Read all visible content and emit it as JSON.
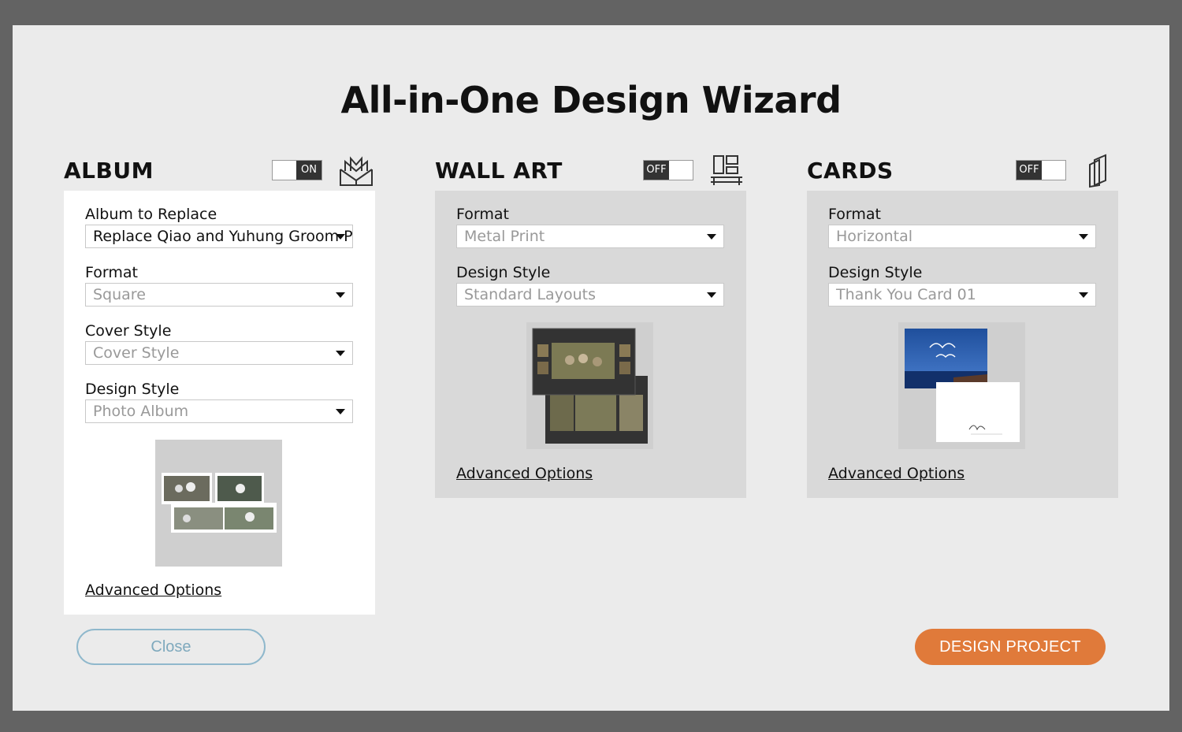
{
  "dialog": {
    "title": "All-in-One Design Wizard"
  },
  "album": {
    "title": "ALBUM",
    "toggle": "ON",
    "icon": "open-book-icon",
    "fields": [
      {
        "label": "Album to Replace",
        "value": "Replace Qiao and Yuhung Groom Pa"
      },
      {
        "label": "Format",
        "value": "Square"
      },
      {
        "label": "Cover Style",
        "value": "Cover Style"
      },
      {
        "label": "Design Style",
        "value": "Photo Album"
      }
    ],
    "advanced": "Advanced Options"
  },
  "wallart": {
    "title": "WALL ART",
    "toggle": "OFF",
    "icon": "wall-frames-icon",
    "fields": [
      {
        "label": "Format",
        "value": "Metal Print"
      },
      {
        "label": "Design Style",
        "value": "Standard Layouts"
      }
    ],
    "advanced": "Advanced Options"
  },
  "cards": {
    "title": "CARDS",
    "toggle": "OFF",
    "icon": "stacked-cards-icon",
    "fields": [
      {
        "label": "Format",
        "value": "Horizontal"
      },
      {
        "label": "Design Style",
        "value": "Thank You Card 01"
      }
    ],
    "advanced": "Advanced Options"
  },
  "buttons": {
    "close": "Close",
    "design": "DESIGN PROJECT"
  },
  "colors": {
    "accent": "#e07a3a",
    "close_border": "#8fb8cc",
    "dialog_bg": "#ebebeb",
    "panel_grey": "#d9d9d9"
  }
}
